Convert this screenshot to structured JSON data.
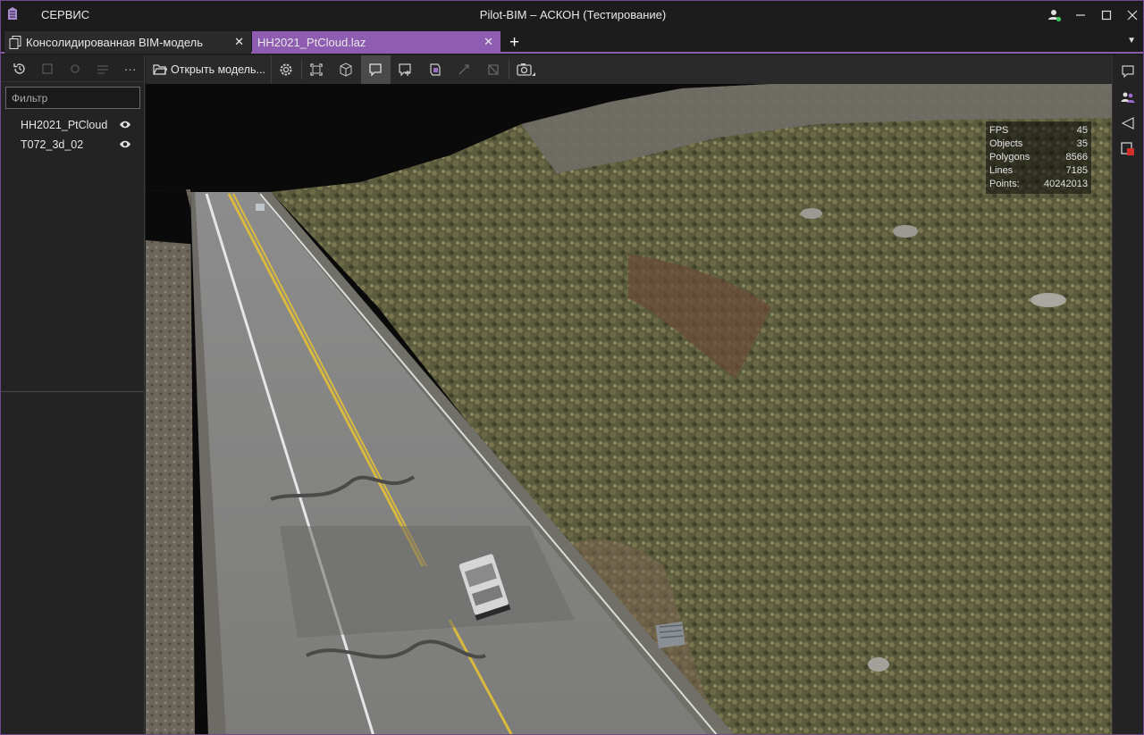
{
  "app": {
    "title": "Pilot-BIM – АСКОН (Тестирование)",
    "menu_service": "СЕРВИС"
  },
  "tabs": [
    {
      "label": "Консолидированная BIM-модель",
      "active": false
    },
    {
      "label": "HH2021_PtCloud.laz",
      "active": true
    }
  ],
  "left_panel": {
    "filter_placeholder": "Фильтр",
    "items": [
      {
        "label": "HH2021_PtCloud",
        "visible": true
      },
      {
        "label": "T072_3d_02",
        "visible": true
      }
    ]
  },
  "viewer_toolbar": {
    "open_model_label": "Открыть модель..."
  },
  "stats": [
    {
      "label": "FPS",
      "value": "45"
    },
    {
      "label": "Objects",
      "value": "35"
    },
    {
      "label": "Polygons",
      "value": "8566"
    },
    {
      "label": "Lines",
      "value": "7185"
    },
    {
      "label": "Points:",
      "value": "40242013"
    }
  ],
  "colors": {
    "accent": "#8e5cb0",
    "background": "#1f1f1f",
    "panel": "#232323"
  },
  "icons": {
    "window": [
      "user-online-icon",
      "minimize-icon",
      "maximize-icon",
      "close-icon"
    ],
    "left_toolbar": [
      "history-icon",
      "fit-icon",
      "hide-icon",
      "layers-icon",
      "more-icon"
    ],
    "right_strip": [
      "comments-icon",
      "users-icon",
      "send-icon",
      "remarks-icon"
    ]
  }
}
